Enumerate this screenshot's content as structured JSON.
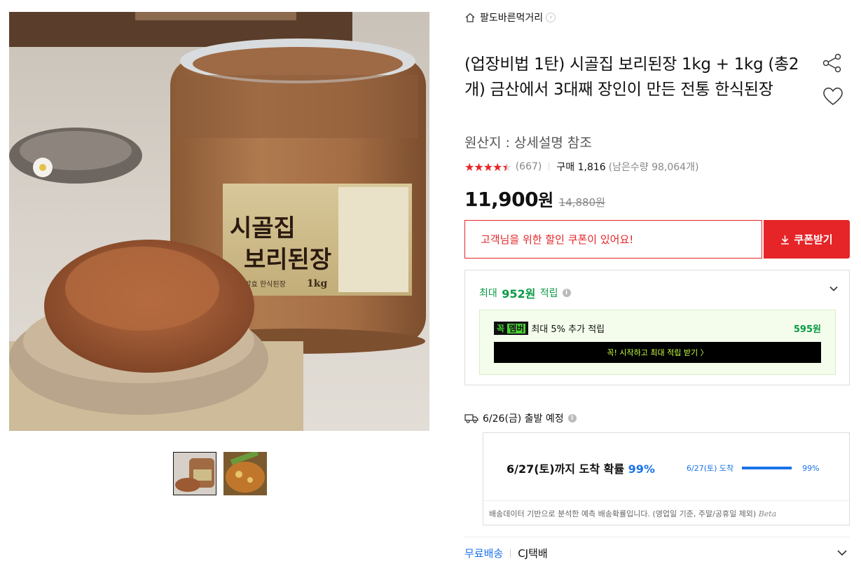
{
  "store": {
    "name": "팔도바른먹거리"
  },
  "product": {
    "title": "(업장비법 1탄) 시골집 보리된장 1kg + 1kg (총2개) 금산에서 3대째 장인이 만든 전통 한식된장",
    "origin": "원산지 : 상세설명 참조",
    "label_line1": "시골집",
    "label_line2": "보리된장",
    "label_sub": "자연발효 한식된장",
    "label_weight": "1kg"
  },
  "rating": {
    "stars": 4.5,
    "review_count": "(667)",
    "purchase": "구매 1,816",
    "remaining": "(남은수량 98,064개)"
  },
  "price": {
    "sale": "11,900",
    "won": "원",
    "original": "14,880원"
  },
  "coupon": {
    "message": "고객님을 위한 할인 쿠폰이 있어요!",
    "button": "쿠폰받기"
  },
  "reward": {
    "prefix": "최대",
    "amount": "952원",
    "suffix": "적립",
    "member_badge_a": "꼭",
    "member_badge_b": "멤버",
    "member_text": "최대 5% 추가 적립",
    "member_amount": "595원",
    "member_cta": "꼭! 시작하고 최대 적립 받기 〉"
  },
  "shipping": {
    "depart": "6/26(금) 출발 예정",
    "prob_text": "6/27(토)까지 도착 확률",
    "prob_pct": "99%",
    "mini_label": "6/27(토) 도착",
    "mini_pct": "99%",
    "prob_value": 0.99,
    "note": "배송데이터 기반으로 분석한 예측 배송확률입니다. (영업일 기준, 주말/공휴일 제외)",
    "beta": "Beta",
    "free": "무료배송",
    "courier": "CJ택배"
  },
  "colors": {
    "accent_red": "#e52528",
    "accent_green": "#0a9a46",
    "accent_blue": "#1a73e8"
  }
}
